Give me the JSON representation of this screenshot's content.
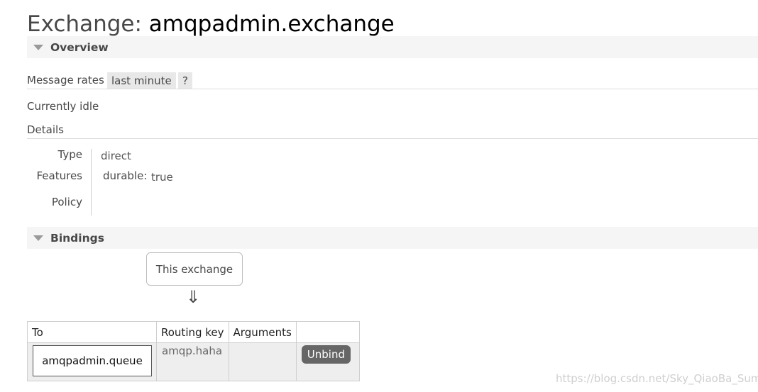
{
  "page_title_prefix": "Exchange: ",
  "page_title_name": "amqpadmin.exchange",
  "overview": {
    "header": "Overview",
    "message_rates_label": "Message rates",
    "rate_period": "last minute",
    "help": "?",
    "status": "Currently idle",
    "details_label": "Details",
    "type_label": "Type",
    "type_value": "direct",
    "features_label": "Features",
    "feature_key": "durable:",
    "feature_value": "true",
    "policy_label": "Policy"
  },
  "bindings": {
    "header": "Bindings",
    "source_label": "This exchange",
    "arrow": "⇓",
    "columns": [
      "To",
      "Routing key",
      "Arguments",
      ""
    ],
    "rows": [
      {
        "to": "amqpadmin.queue",
        "routing_key": "amqp.haha",
        "arguments": "",
        "action": "Unbind"
      }
    ]
  },
  "watermark": "https://blog.csdn.net/Sky_QiaoBa_Sum"
}
